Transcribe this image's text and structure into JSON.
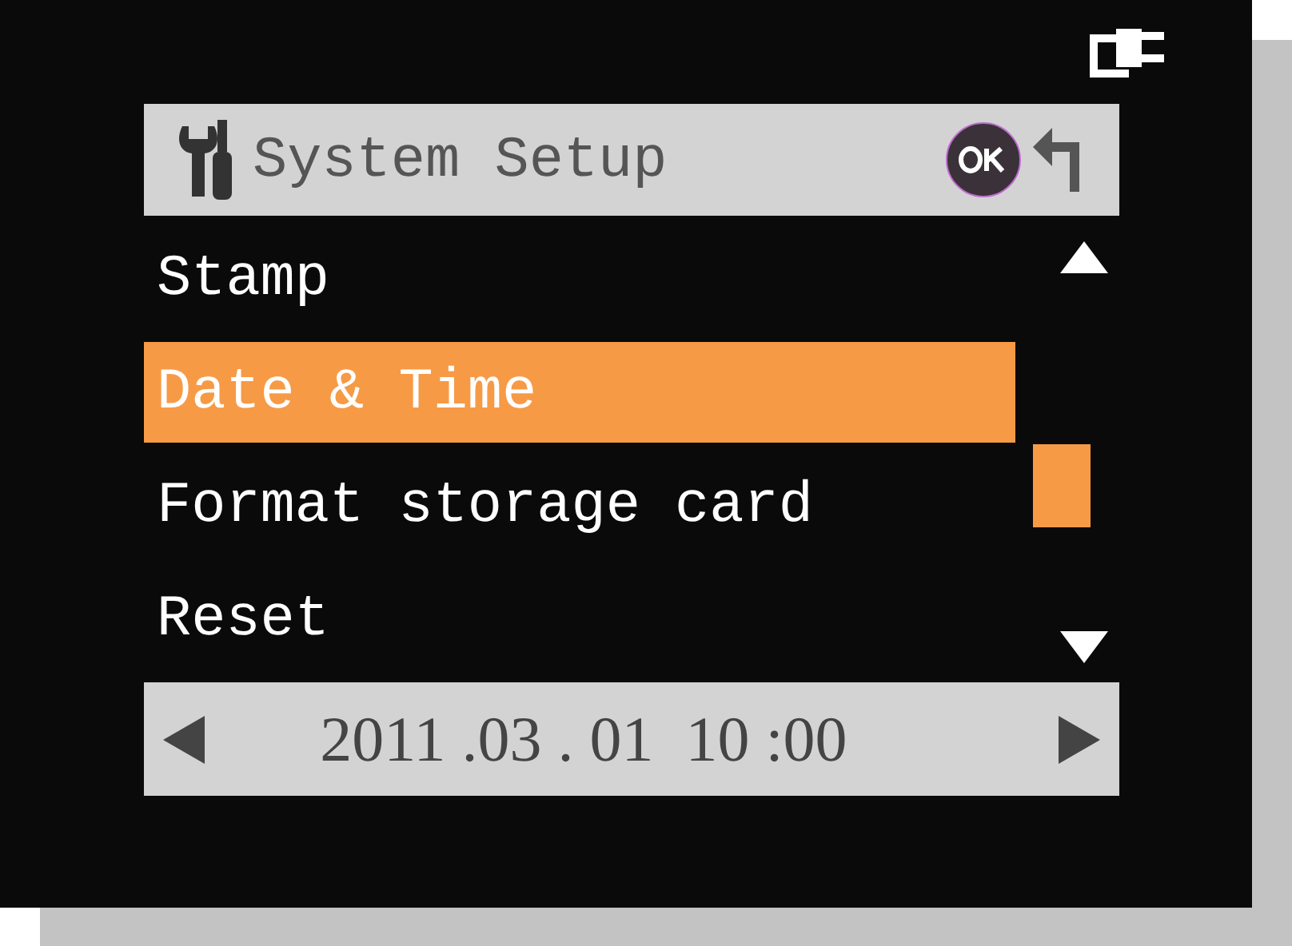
{
  "header": {
    "title": "System Setup"
  },
  "menu": [
    {
      "label": "Stamp",
      "selected": false
    },
    {
      "label": "Date & Time",
      "selected": true
    },
    {
      "label": "Format storage card",
      "selected": false
    },
    {
      "label": "Reset",
      "selected": false
    }
  ],
  "value_bar": {
    "value": "2011 .03 . 01  10 :00"
  }
}
